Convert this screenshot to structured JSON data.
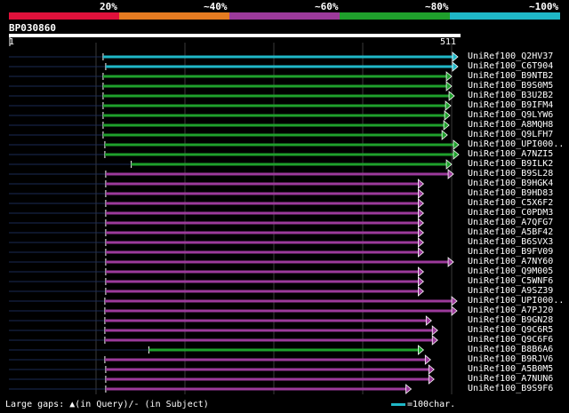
{
  "scale": {
    "labels": [
      "20%",
      "~40%",
      "~60%",
      "~80%",
      "~100%"
    ],
    "colors": [
      "#e0113b",
      "#e57b21",
      "#9c3a9b",
      "#1fa02c",
      "#1fb7c7"
    ]
  },
  "query": {
    "id": "BP030860",
    "start": "1",
    "end": "511",
    "length": 511
  },
  "hits": [
    {
      "label": "UniRef100_Q2HV37",
      "color": "#1fb7c7",
      "start": 108,
      "end": 511
    },
    {
      "label": "UniRef100_C6T904",
      "color": "#1fb7c7",
      "start": 111,
      "end": 511
    },
    {
      "label": "UniRef100_B9NTB2",
      "color": "#1fa02c",
      "start": 108,
      "end": 504
    },
    {
      "label": "UniRef100_B9S0M5",
      "color": "#1fa02c",
      "start": 108,
      "end": 504
    },
    {
      "label": "UniRef100_B3U2B2",
      "color": "#1fa02c",
      "start": 108,
      "end": 507
    },
    {
      "label": "UniRef100_B9IFM4",
      "color": "#1fa02c",
      "start": 108,
      "end": 503
    },
    {
      "label": "UniRef100_Q9LYW6",
      "color": "#1fa02c",
      "start": 108,
      "end": 502
    },
    {
      "label": "UniRef100_A8MQH8",
      "color": "#1fa02c",
      "start": 108,
      "end": 501
    },
    {
      "label": "UniRef100_Q9LFH7",
      "color": "#1fa02c",
      "start": 108,
      "end": 499
    },
    {
      "label": "UniRef100_UPI000..",
      "color": "#1fa02c",
      "start": 110,
      "end": 512
    },
    {
      "label": "UniRef100_A7NZI5",
      "color": "#1fa02c",
      "start": 110,
      "end": 512
    },
    {
      "label": "UniRef100_B9ILK2",
      "color": "#1fa02c",
      "start": 140,
      "end": 504
    },
    {
      "label": "UniRef100_B9SL28",
      "color": "#9c3a9b",
      "start": 111,
      "end": 506
    },
    {
      "label": "UniRef100_B9HGK4",
      "color": "#9c3a9b",
      "start": 111,
      "end": 472
    },
    {
      "label": "UniRef100_B9HD83",
      "color": "#9c3a9b",
      "start": 111,
      "end": 472
    },
    {
      "label": "UniRef100_C5X6F2",
      "color": "#9c3a9b",
      "start": 111,
      "end": 472
    },
    {
      "label": "UniRef100_C0PDM3",
      "color": "#9c3a9b",
      "start": 111,
      "end": 472
    },
    {
      "label": "UniRef100_A7QFG7",
      "color": "#9c3a9b",
      "start": 111,
      "end": 472
    },
    {
      "label": "UniRef100_A5BF42",
      "color": "#9c3a9b",
      "start": 111,
      "end": 472
    },
    {
      "label": "UniRef100_B6SVX3",
      "color": "#9c3a9b",
      "start": 111,
      "end": 472
    },
    {
      "label": "UniRef100_B9FV09",
      "color": "#9c3a9b",
      "start": 111,
      "end": 472
    },
    {
      "label": "UniRef100_A7NY60",
      "color": "#9c3a9b",
      "start": 111,
      "end": 506
    },
    {
      "label": "UniRef100_Q9M005",
      "color": "#9c3a9b",
      "start": 111,
      "end": 472
    },
    {
      "label": "UniRef100_C5WNF6",
      "color": "#9c3a9b",
      "start": 111,
      "end": 472
    },
    {
      "label": "UniRef100_A9SZ39",
      "color": "#9c3a9b",
      "start": 111,
      "end": 472
    },
    {
      "label": "UniRef100_UPI000..",
      "color": "#9c3a9b",
      "start": 110,
      "end": 510
    },
    {
      "label": "UniRef100_A7PJ20",
      "color": "#9c3a9b",
      "start": 110,
      "end": 510
    },
    {
      "label": "UniRef100_B9GN28",
      "color": "#9c3a9b",
      "start": 110,
      "end": 481
    },
    {
      "label": "UniRef100_Q9C6R5",
      "color": "#9c3a9b",
      "start": 110,
      "end": 488
    },
    {
      "label": "UniRef100_Q9C6F6",
      "color": "#9c3a9b",
      "start": 110,
      "end": 488
    },
    {
      "label": "UniRef100_B8B6A6",
      "color": "#1fa02c",
      "start": 160,
      "end": 472
    },
    {
      "label": "UniRef100_B9RJV6",
      "color": "#9c3a9b",
      "start": 110,
      "end": 480
    },
    {
      "label": "UniRef100_A5B0M5",
      "color": "#9c3a9b",
      "start": 111,
      "end": 484
    },
    {
      "label": "UniRef100_A7NUN6",
      "color": "#9c3a9b",
      "start": 111,
      "end": 484
    },
    {
      "label": "UniRef100_B9S9F6",
      "color": "#9c3a9b",
      "start": 111,
      "end": 458
    }
  ],
  "footer": {
    "gaps_text": "Large gaps: ▲(in Query)/- (in Subject)",
    "legend_text": "=100char."
  },
  "legend_icon": "cyan-line"
}
